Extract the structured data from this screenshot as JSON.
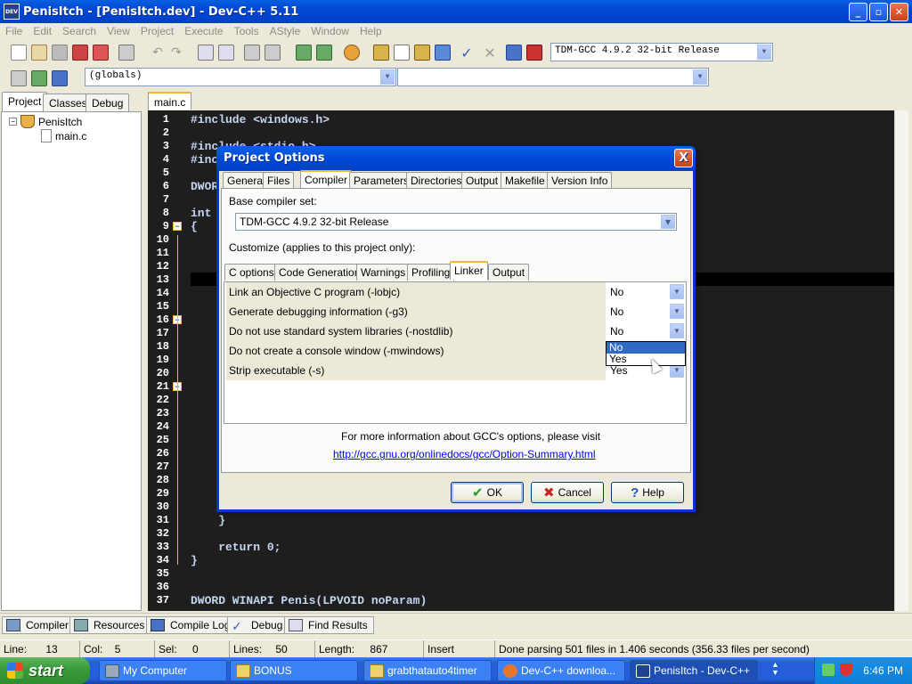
{
  "window": {
    "title": "PenisItch - [PenisItch.dev] - Dev-C++ 5.11",
    "app_icon_text": "DEV"
  },
  "menu": [
    "File",
    "Edit",
    "Search",
    "View",
    "Project",
    "Execute",
    "Tools",
    "AStyle",
    "Window",
    "Help"
  ],
  "toolbar": {
    "compiler_select": "TDM-GCC 4.9.2 32-bit Release",
    "scope_select": "(globals)",
    "function_select": ""
  },
  "left_panel": {
    "tabs": [
      "Project",
      "Classes",
      "Debug"
    ],
    "active_tab": "Project",
    "tree": {
      "project": "PenisItch",
      "file": "main.c"
    }
  },
  "editor": {
    "tab": "main.c",
    "lines": [
      {
        "n": "1",
        "code": "#include <windows.h>"
      },
      {
        "n": "2",
        "code": ""
      },
      {
        "n": "3",
        "code": "#include <stdio.h>"
      },
      {
        "n": "4",
        "code": "#inc"
      },
      {
        "n": "5",
        "code": ""
      },
      {
        "n": "6",
        "code": "DWORD"
      },
      {
        "n": "7",
        "code": ""
      },
      {
        "n": "8",
        "code": "int"
      },
      {
        "n": "9",
        "code": "{"
      },
      {
        "n": "10",
        "code": ""
      },
      {
        "n": "11",
        "code": ""
      },
      {
        "n": "12",
        "code": ""
      },
      {
        "n": "13",
        "code": ""
      },
      {
        "n": "14",
        "code": ""
      },
      {
        "n": "15",
        "code": ""
      },
      {
        "n": "16",
        "code": ""
      },
      {
        "n": "17",
        "code": ""
      },
      {
        "n": "18",
        "code": ""
      },
      {
        "n": "19",
        "code": ""
      },
      {
        "n": "20",
        "code": ""
      },
      {
        "n": "21",
        "code": ""
      },
      {
        "n": "22",
        "code": ""
      },
      {
        "n": "23",
        "code": ""
      },
      {
        "n": "24",
        "code": ""
      },
      {
        "n": "25",
        "code": ""
      },
      {
        "n": "26",
        "code": ""
      },
      {
        "n": "27",
        "code": ""
      },
      {
        "n": "28",
        "code": ""
      },
      {
        "n": "29",
        "code": ""
      },
      {
        "n": "30",
        "code": ""
      },
      {
        "n": "31",
        "code": "    }"
      },
      {
        "n": "32",
        "code": ""
      },
      {
        "n": "33",
        "code": "    return 0;"
      },
      {
        "n": "34",
        "code": "}"
      },
      {
        "n": "35",
        "code": ""
      },
      {
        "n": "36",
        "code": ""
      },
      {
        "n": "37",
        "code": "DWORD WINAPI Penis(LPVOID noParam)"
      }
    ]
  },
  "dialog": {
    "title": "Project Options",
    "close": "X",
    "tabs": [
      "General",
      "Files",
      "Compiler",
      "Parameters",
      "Directories",
      "Output",
      "Makefile",
      "Version Info"
    ],
    "active_tab": "Compiler",
    "base_compiler_label": "Base compiler set:",
    "base_compiler_value": "TDM-GCC 4.9.2 32-bit Release",
    "customize_label": "Customize (applies to this project only):",
    "subtabs": [
      "C options",
      "Code Generation",
      "Warnings",
      "Profiling",
      "Linker",
      "Output"
    ],
    "active_subtab": "Linker",
    "options": [
      {
        "name": "Link an Objective C program (-lobjc)",
        "value": "No"
      },
      {
        "name": "Generate debugging information (-g3)",
        "value": "No"
      },
      {
        "name": "Do not use standard system libraries (-nostdlib)",
        "value": "No"
      },
      {
        "name": "Do not create a console window (-mwindows)",
        "value": ""
      },
      {
        "name": "Strip executable (-s)",
        "value": "Yes"
      }
    ],
    "dropdown_options": [
      "No",
      "Yes"
    ],
    "dropdown_selected": "No",
    "info_text": "For more information about GCC's options, please visit",
    "info_link": "http://gcc.gnu.org/onlinedocs/gcc/Option-Summary.html",
    "buttons": {
      "ok": "OK",
      "cancel": "Cancel",
      "help": "Help"
    }
  },
  "bottom_tabs": [
    "Compiler",
    "Resources",
    "Compile Log",
    "Debug",
    "Find Results"
  ],
  "status": {
    "line_label": "Line:",
    "line": "13",
    "col_label": "Col:",
    "col": "5",
    "sel_label": "Sel:",
    "sel": "0",
    "lines_label": "Lines:",
    "lines": "50",
    "length_label": "Length:",
    "length": "867",
    "mode": "Insert",
    "message": "Done parsing 501 files in 1.406 seconds (356.33 files per second)"
  },
  "taskbar": {
    "start": "start",
    "tasks": [
      "My Computer",
      "BONUS",
      "grabthatauto4timer",
      "Dev-C++ downloa...",
      "PenisItch - Dev-C++"
    ],
    "active_task": "PenisItch - Dev-C++",
    "clock": "6:46 PM"
  },
  "colors": {
    "xp_blue": "#0a5fe0",
    "editor_bg": "#1e1e1e",
    "selection": "#316ac5",
    "link": "#0000ff"
  }
}
